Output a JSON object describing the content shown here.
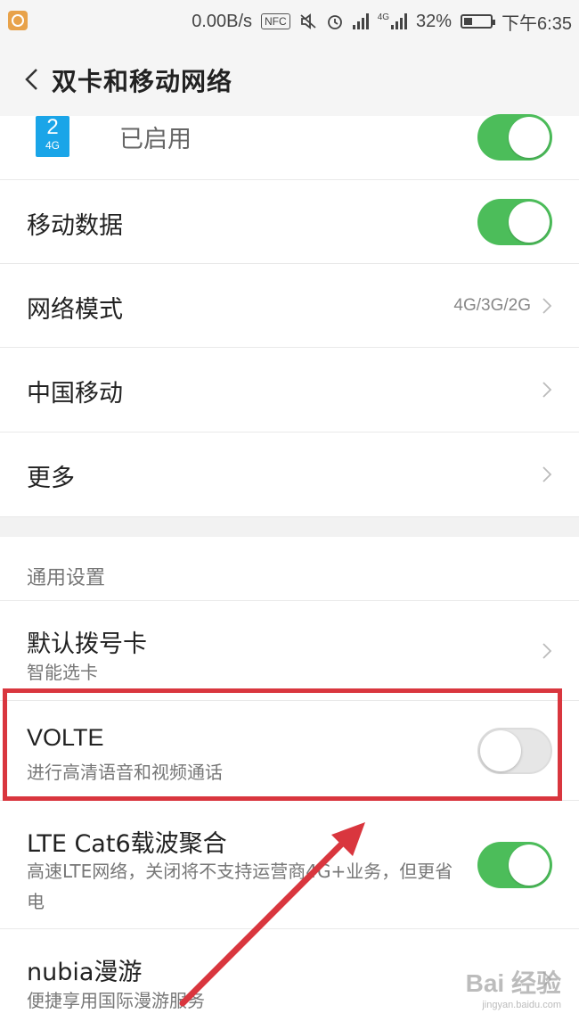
{
  "status_bar": {
    "speed": "0.00B/s",
    "nfc": "NFC",
    "network_type": "4G",
    "battery": "32%",
    "battery_level": 0.32,
    "time": "下午6:35",
    "icons": [
      "app-icon",
      "mute-icon",
      "alarm-icon",
      "signal-icon",
      "signal-4g-icon",
      "battery-icon"
    ]
  },
  "header": {
    "title": "双卡和移动网络"
  },
  "sim_row": {
    "sim_number": "2",
    "sim_network": "4G",
    "label": "已启用",
    "enabled": true
  },
  "rows": {
    "mobile_data": {
      "label": "移动数据",
      "enabled": true
    },
    "network_mode": {
      "label": "网络模式",
      "value": "4G/3G/2G"
    },
    "carrier": {
      "label": "中国移动"
    },
    "more": {
      "label": "更多"
    }
  },
  "general": {
    "header": "通用设置",
    "default_dial": {
      "label": "默认拨号卡",
      "sub": "智能选卡"
    },
    "volte": {
      "label": "VOLTE",
      "sub": "进行高清语音和视频通话",
      "enabled": false
    },
    "lte_cat6": {
      "label": "LTE Cat6载波聚合",
      "sub": "高速LTE网络，关闭将不支持运营商4G+业务，但更省电",
      "enabled": true
    },
    "roaming": {
      "label": "nubia漫游",
      "sub": "便捷享用国际漫游服务"
    }
  },
  "watermark": {
    "main": "Bai 经验",
    "sub": "jingyan.baidu.com"
  },
  "colors": {
    "toggle_on": "#4cbd5a",
    "sim_badge": "#1aa5e8",
    "highlight": "#d9363e"
  }
}
